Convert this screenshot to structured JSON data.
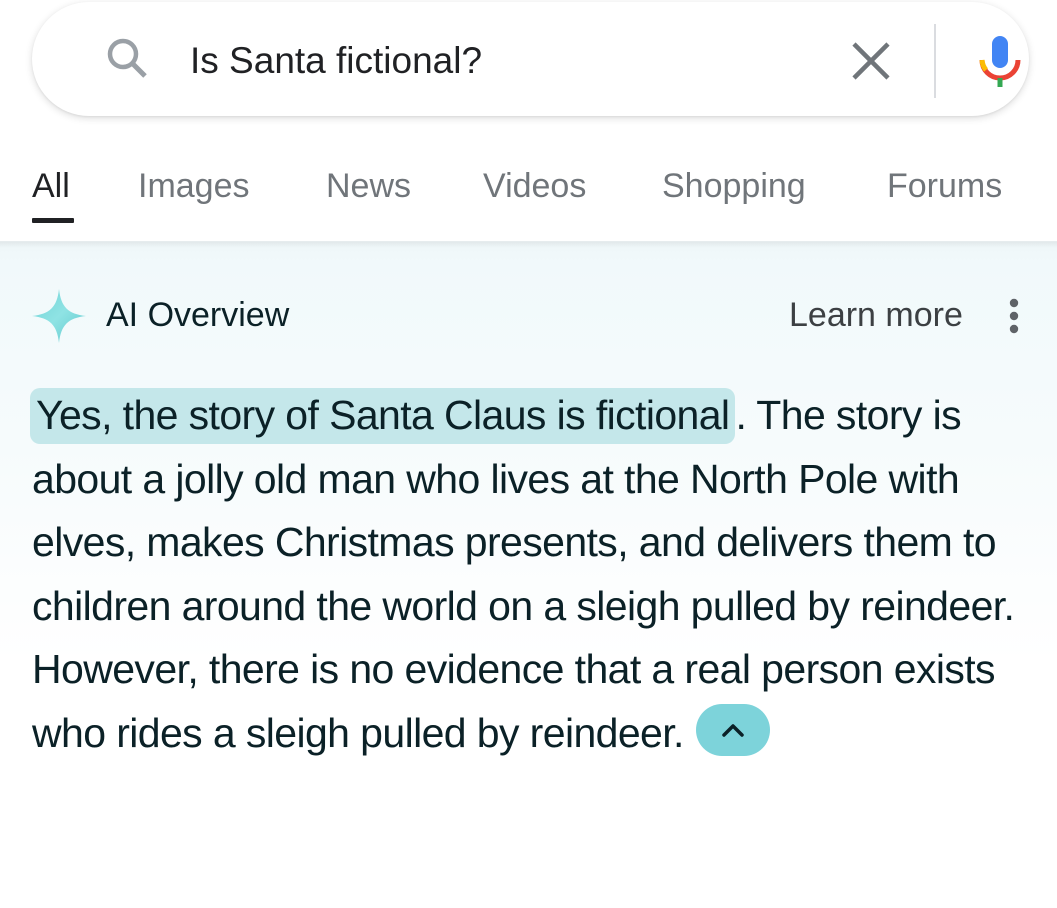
{
  "search": {
    "query": "Is Santa fictional?",
    "icons": {
      "search": "search-icon",
      "clear": "close-icon",
      "voice": "mic-icon"
    }
  },
  "tabs": [
    {
      "label": "All",
      "active": true
    },
    {
      "label": "Images",
      "active": false
    },
    {
      "label": "News",
      "active": false
    },
    {
      "label": "Videos",
      "active": false
    },
    {
      "label": "Shopping",
      "active": false
    },
    {
      "label": "Forums",
      "active": false
    }
  ],
  "ai_overview": {
    "title": "AI Overview",
    "learn_more_label": "Learn more",
    "icons": {
      "sparkle": "sparkle-icon",
      "more": "more-vert-icon",
      "collapse": "chevron-up-icon"
    },
    "answer": {
      "highlighted": "Yes, the story of Santa Claus is fictional",
      "rest": ". The story is about a jolly old man who lives at the North Pole with elves, makes Christmas presents, and delivers them to children around the world on a sleigh pulled by reindeer. However, there is no evidence that a real person exists who rides a sleigh pulled by reindeer."
    }
  },
  "colors": {
    "highlight": "#c4e7ea",
    "collapse_button": "#7dd3da",
    "text_primary": "#0b2127",
    "tab_inactive": "#70757a",
    "mic_blue": "#4285f4",
    "mic_red": "#ea4335",
    "mic_yellow": "#fbbc04",
    "mic_green": "#34a853"
  }
}
